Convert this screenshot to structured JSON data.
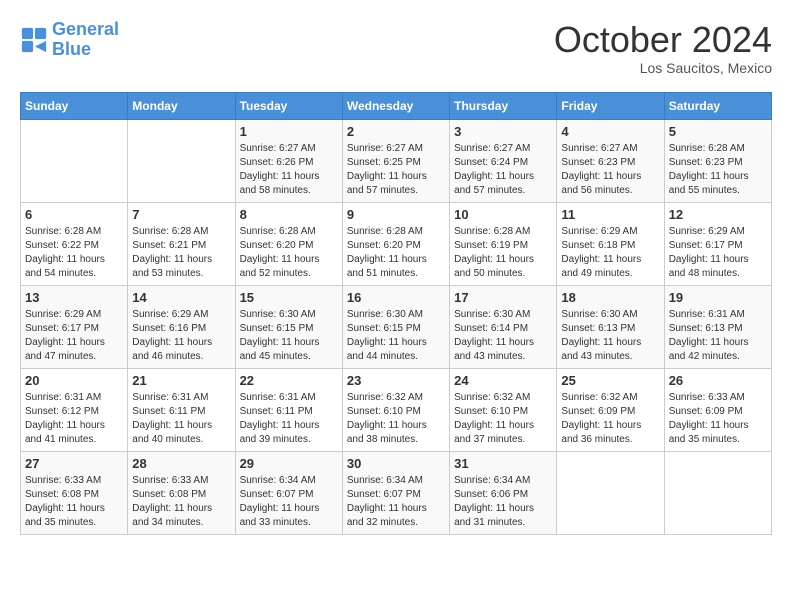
{
  "header": {
    "logo_line1": "General",
    "logo_line2": "Blue",
    "month_title": "October 2024",
    "subtitle": "Los Saucitos, Mexico"
  },
  "weekdays": [
    "Sunday",
    "Monday",
    "Tuesday",
    "Wednesday",
    "Thursday",
    "Friday",
    "Saturday"
  ],
  "weeks": [
    [
      {
        "day": "",
        "info": ""
      },
      {
        "day": "",
        "info": ""
      },
      {
        "day": "1",
        "info": "Sunrise: 6:27 AM\nSunset: 6:26 PM\nDaylight: 11 hours and 58 minutes."
      },
      {
        "day": "2",
        "info": "Sunrise: 6:27 AM\nSunset: 6:25 PM\nDaylight: 11 hours and 57 minutes."
      },
      {
        "day": "3",
        "info": "Sunrise: 6:27 AM\nSunset: 6:24 PM\nDaylight: 11 hours and 57 minutes."
      },
      {
        "day": "4",
        "info": "Sunrise: 6:27 AM\nSunset: 6:23 PM\nDaylight: 11 hours and 56 minutes."
      },
      {
        "day": "5",
        "info": "Sunrise: 6:28 AM\nSunset: 6:23 PM\nDaylight: 11 hours and 55 minutes."
      }
    ],
    [
      {
        "day": "6",
        "info": "Sunrise: 6:28 AM\nSunset: 6:22 PM\nDaylight: 11 hours and 54 minutes."
      },
      {
        "day": "7",
        "info": "Sunrise: 6:28 AM\nSunset: 6:21 PM\nDaylight: 11 hours and 53 minutes."
      },
      {
        "day": "8",
        "info": "Sunrise: 6:28 AM\nSunset: 6:20 PM\nDaylight: 11 hours and 52 minutes."
      },
      {
        "day": "9",
        "info": "Sunrise: 6:28 AM\nSunset: 6:20 PM\nDaylight: 11 hours and 51 minutes."
      },
      {
        "day": "10",
        "info": "Sunrise: 6:28 AM\nSunset: 6:19 PM\nDaylight: 11 hours and 50 minutes."
      },
      {
        "day": "11",
        "info": "Sunrise: 6:29 AM\nSunset: 6:18 PM\nDaylight: 11 hours and 49 minutes."
      },
      {
        "day": "12",
        "info": "Sunrise: 6:29 AM\nSunset: 6:17 PM\nDaylight: 11 hours and 48 minutes."
      }
    ],
    [
      {
        "day": "13",
        "info": "Sunrise: 6:29 AM\nSunset: 6:17 PM\nDaylight: 11 hours and 47 minutes."
      },
      {
        "day": "14",
        "info": "Sunrise: 6:29 AM\nSunset: 6:16 PM\nDaylight: 11 hours and 46 minutes."
      },
      {
        "day": "15",
        "info": "Sunrise: 6:30 AM\nSunset: 6:15 PM\nDaylight: 11 hours and 45 minutes."
      },
      {
        "day": "16",
        "info": "Sunrise: 6:30 AM\nSunset: 6:15 PM\nDaylight: 11 hours and 44 minutes."
      },
      {
        "day": "17",
        "info": "Sunrise: 6:30 AM\nSunset: 6:14 PM\nDaylight: 11 hours and 43 minutes."
      },
      {
        "day": "18",
        "info": "Sunrise: 6:30 AM\nSunset: 6:13 PM\nDaylight: 11 hours and 43 minutes."
      },
      {
        "day": "19",
        "info": "Sunrise: 6:31 AM\nSunset: 6:13 PM\nDaylight: 11 hours and 42 minutes."
      }
    ],
    [
      {
        "day": "20",
        "info": "Sunrise: 6:31 AM\nSunset: 6:12 PM\nDaylight: 11 hours and 41 minutes."
      },
      {
        "day": "21",
        "info": "Sunrise: 6:31 AM\nSunset: 6:11 PM\nDaylight: 11 hours and 40 minutes."
      },
      {
        "day": "22",
        "info": "Sunrise: 6:31 AM\nSunset: 6:11 PM\nDaylight: 11 hours and 39 minutes."
      },
      {
        "day": "23",
        "info": "Sunrise: 6:32 AM\nSunset: 6:10 PM\nDaylight: 11 hours and 38 minutes."
      },
      {
        "day": "24",
        "info": "Sunrise: 6:32 AM\nSunset: 6:10 PM\nDaylight: 11 hours and 37 minutes."
      },
      {
        "day": "25",
        "info": "Sunrise: 6:32 AM\nSunset: 6:09 PM\nDaylight: 11 hours and 36 minutes."
      },
      {
        "day": "26",
        "info": "Sunrise: 6:33 AM\nSunset: 6:09 PM\nDaylight: 11 hours and 35 minutes."
      }
    ],
    [
      {
        "day": "27",
        "info": "Sunrise: 6:33 AM\nSunset: 6:08 PM\nDaylight: 11 hours and 35 minutes."
      },
      {
        "day": "28",
        "info": "Sunrise: 6:33 AM\nSunset: 6:08 PM\nDaylight: 11 hours and 34 minutes."
      },
      {
        "day": "29",
        "info": "Sunrise: 6:34 AM\nSunset: 6:07 PM\nDaylight: 11 hours and 33 minutes."
      },
      {
        "day": "30",
        "info": "Sunrise: 6:34 AM\nSunset: 6:07 PM\nDaylight: 11 hours and 32 minutes."
      },
      {
        "day": "31",
        "info": "Sunrise: 6:34 AM\nSunset: 6:06 PM\nDaylight: 11 hours and 31 minutes."
      },
      {
        "day": "",
        "info": ""
      },
      {
        "day": "",
        "info": ""
      }
    ]
  ]
}
